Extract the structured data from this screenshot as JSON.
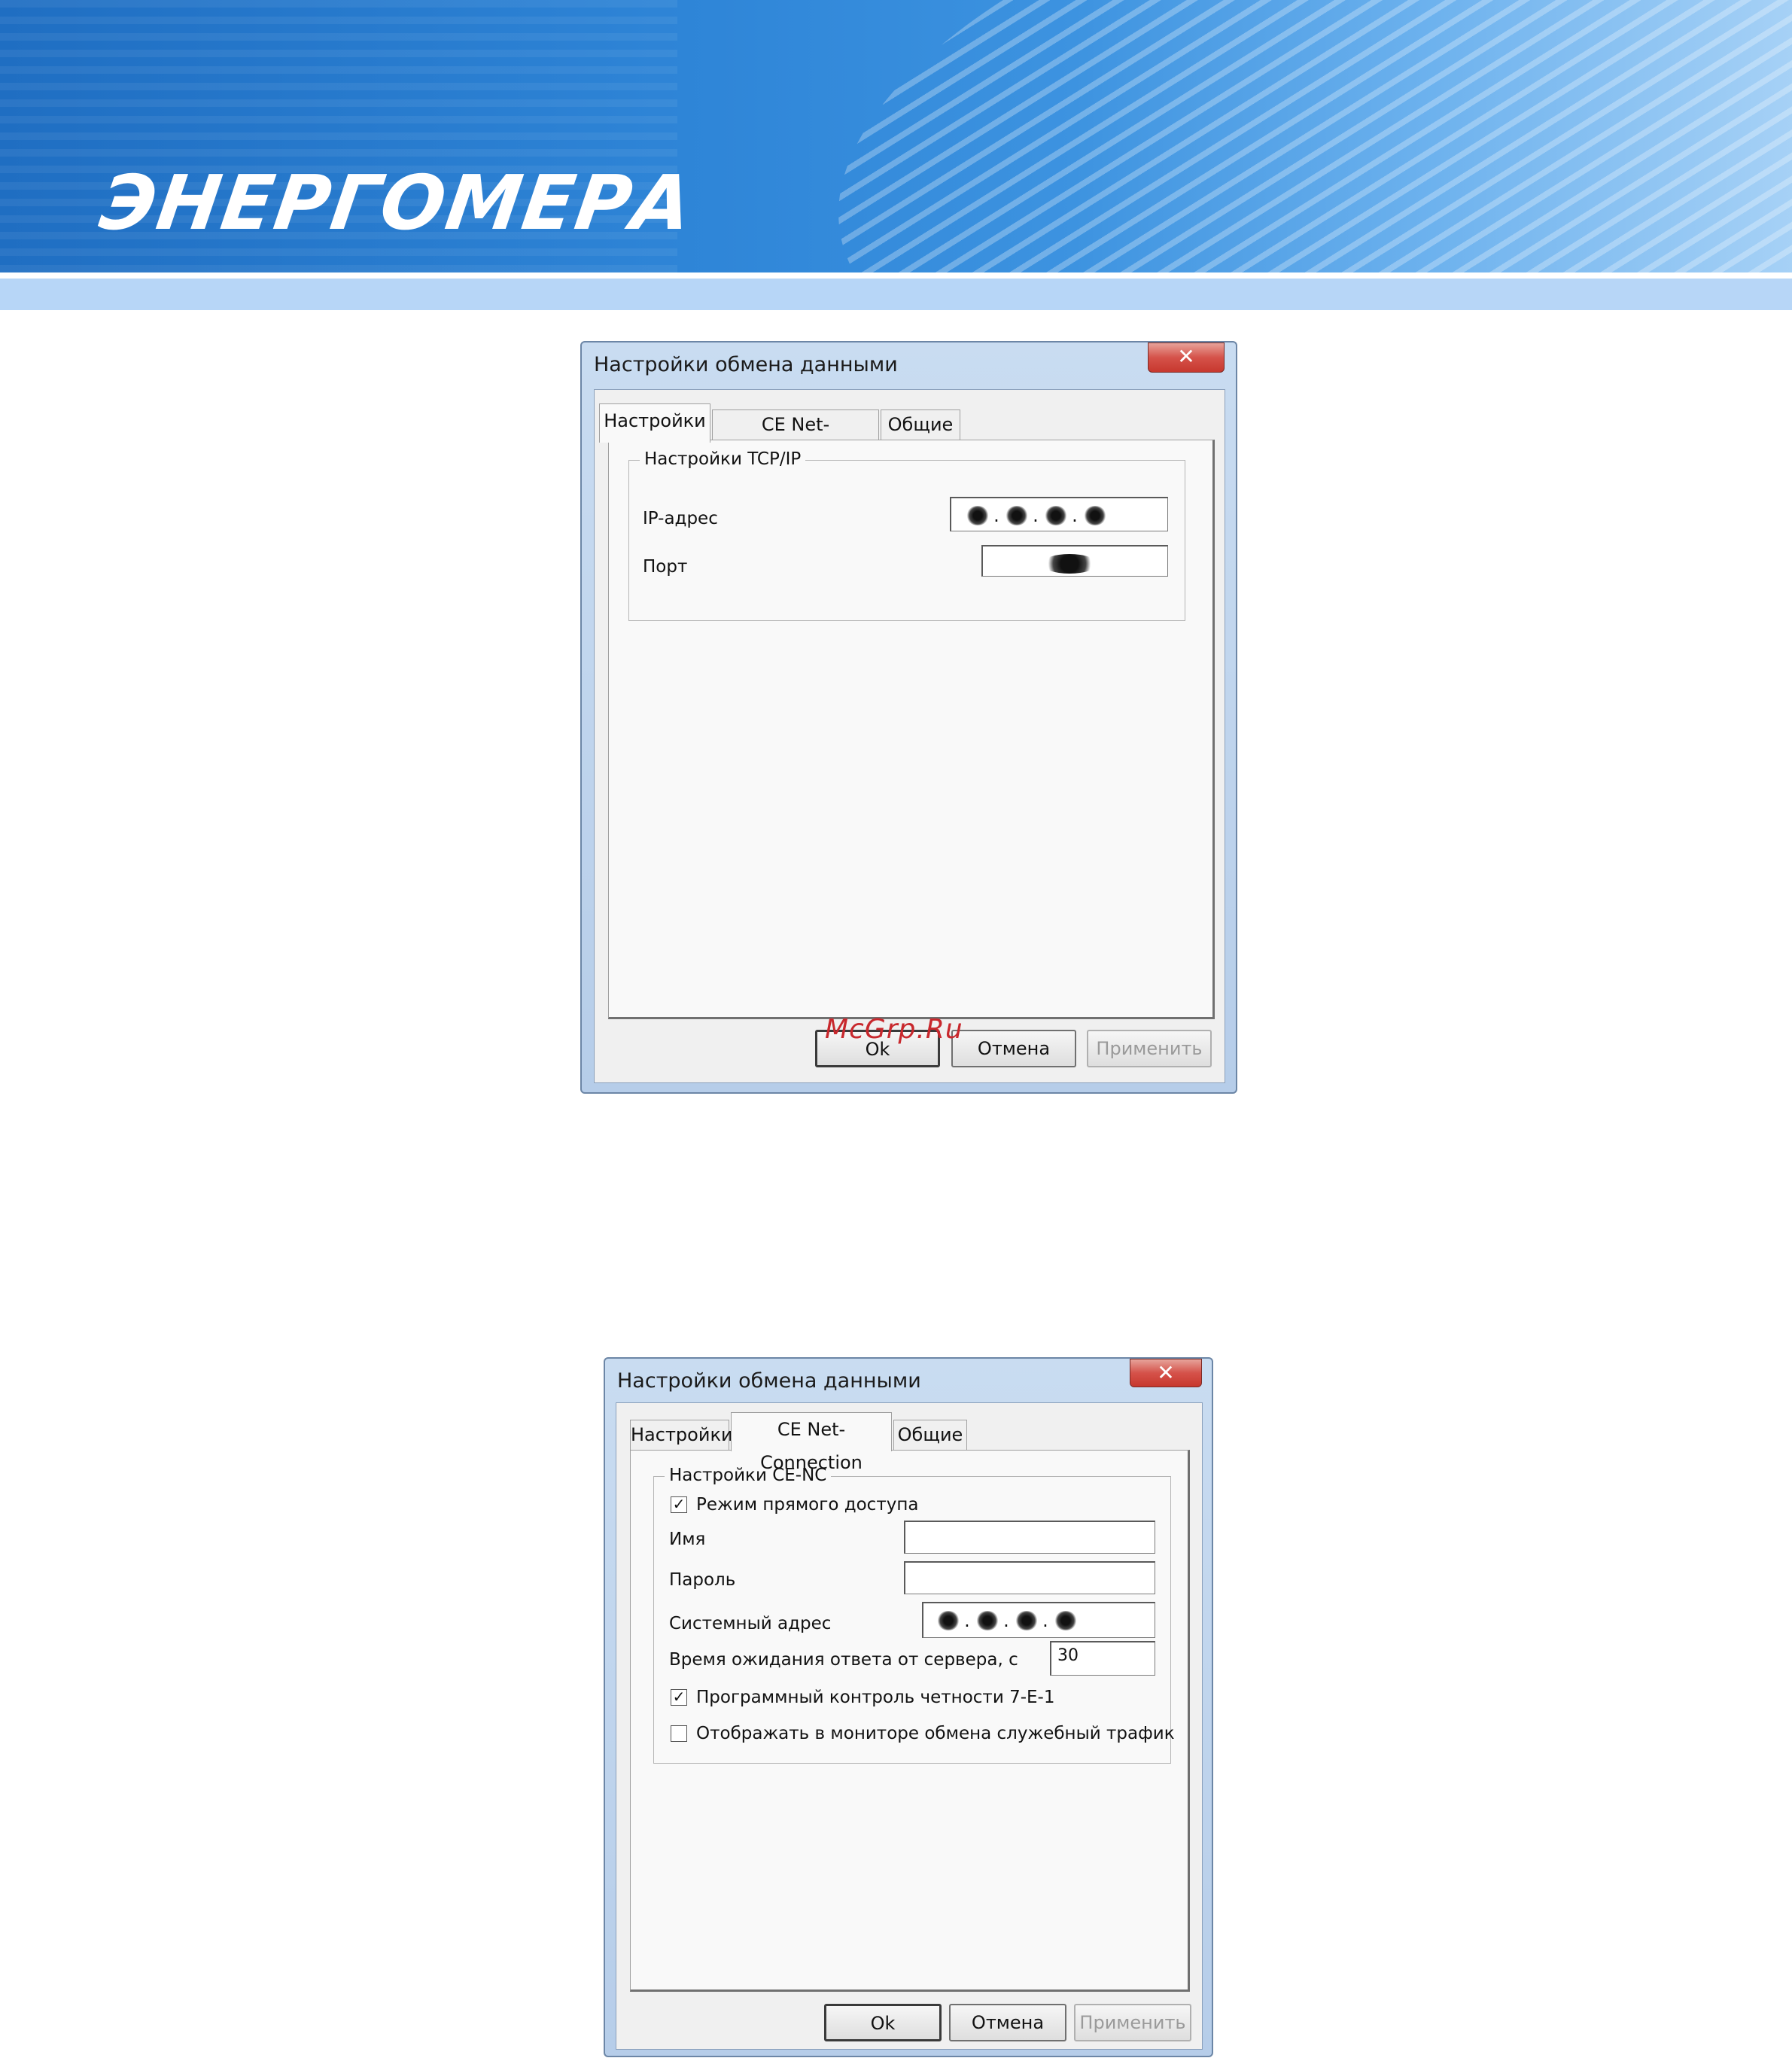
{
  "banner": {
    "logo": "ЭНЕРГОМЕРА"
  },
  "watermark": "McGrp.Ru",
  "dialog1": {
    "title": "Настройки обмена данными",
    "close_glyph": "✕",
    "tabs": [
      {
        "label": "Настройки",
        "active": true
      },
      {
        "label": "CE Net-Connection",
        "active": false
      },
      {
        "label": "Общие",
        "active": false
      }
    ],
    "group": {
      "legend": "Настройки TCP/IP",
      "ip_label": "IP-адрес",
      "port_label": "Порт"
    },
    "buttons": {
      "ok": "Ok",
      "cancel": "Отмена",
      "apply": "Применить"
    }
  },
  "dialog2": {
    "title": "Настройки обмена данными",
    "close_glyph": "✕",
    "tabs": [
      {
        "label": "Настройки",
        "active": false
      },
      {
        "label": "CE Net-Connection",
        "active": true
      },
      {
        "label": "Общие",
        "active": false
      }
    ],
    "group": {
      "legend": "Настройки CE-NC",
      "direct_access": {
        "label": "Режим прямого доступа",
        "checked": true
      },
      "name_label": "Имя",
      "name_value": "",
      "password_label": "Пароль",
      "password_value": "",
      "system_address_label": "Системный адрес",
      "timeout_label": "Время ожидания ответа от сервера, с",
      "timeout_value": "30",
      "parity": {
        "label": "Программный контроль четности 7-Е-1",
        "checked": true
      },
      "show_traffic": {
        "label": "Отображать в мониторе обмена служебный трафик",
        "checked": false
      }
    },
    "buttons": {
      "ok": "Ok",
      "cancel": "Отмена",
      "apply": "Применить"
    }
  }
}
